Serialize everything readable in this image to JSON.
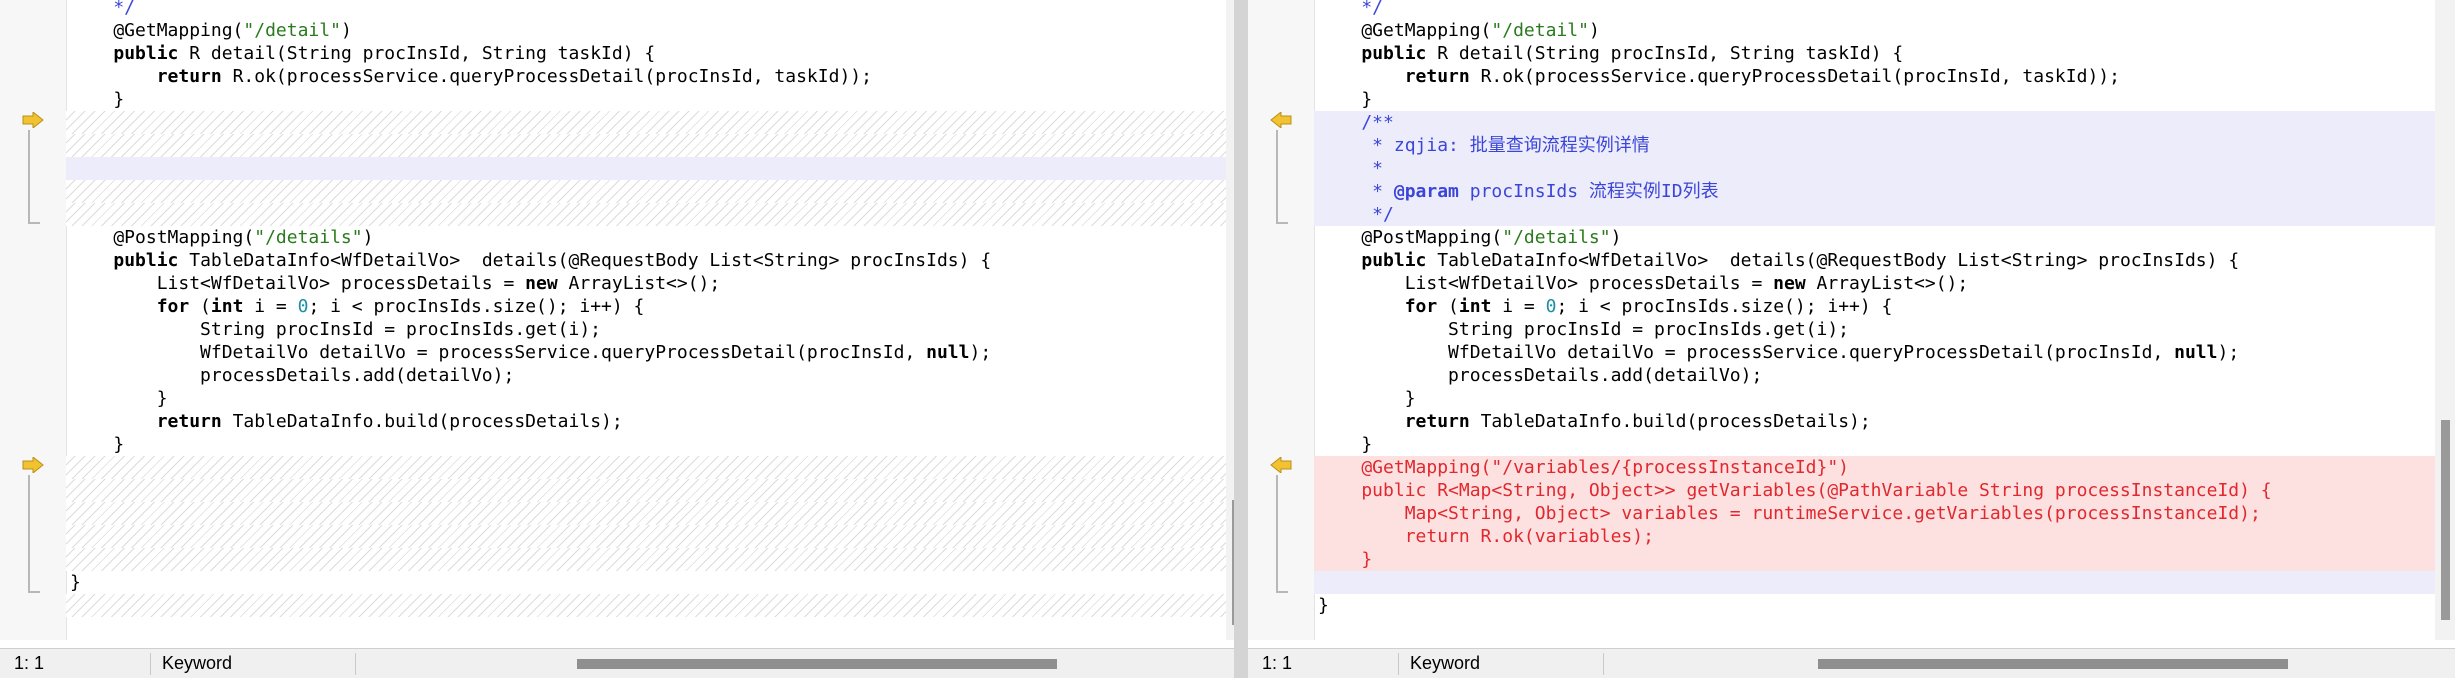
{
  "left_pane": {
    "lines": [
      {
        "t": "    */",
        "cls": "cmt"
      },
      {
        "segs": [
          [
            "    @GetMapping(",
            ""
          ],
          [
            "\"/detail\"",
            "str"
          ],
          [
            ")",
            ""
          ]
        ]
      },
      {
        "segs": [
          [
            "    ",
            ""
          ],
          [
            "public",
            "kw"
          ],
          [
            " R detail(String procInsId, String taskId) {",
            ""
          ]
        ]
      },
      {
        "segs": [
          [
            "        ",
            ""
          ],
          [
            "return",
            "kw"
          ],
          [
            " R.ok(processService.queryProcessDetail(procInsId, taskId));",
            ""
          ]
        ]
      },
      {
        "t": "    }"
      },
      {
        "t": "",
        "bg": "hatch"
      },
      {
        "t": "",
        "bg": "hatch"
      },
      {
        "t": "",
        "bg": "blue"
      },
      {
        "t": "",
        "bg": "hatch"
      },
      {
        "t": "",
        "bg": "hatch"
      },
      {
        "segs": [
          [
            "    @PostMapping(",
            ""
          ],
          [
            "\"/details\"",
            "str"
          ],
          [
            ")",
            ""
          ]
        ]
      },
      {
        "segs": [
          [
            "    ",
            ""
          ],
          [
            "public",
            "kw"
          ],
          [
            " TableDataInfo<WfDetailVo>  details(@RequestBody List<String> procInsIds) {",
            ""
          ]
        ]
      },
      {
        "segs": [
          [
            "        List<WfDetailVo> processDetails = ",
            ""
          ],
          [
            "new",
            "kw"
          ],
          [
            " ArrayList<>();",
            ""
          ]
        ]
      },
      {
        "segs": [
          [
            "        ",
            ""
          ],
          [
            "for",
            "kw"
          ],
          [
            " (",
            ""
          ],
          [
            "int",
            "kw"
          ],
          [
            " i = ",
            ""
          ],
          [
            "0",
            "num"
          ],
          [
            "; i < procInsIds.size(); i++) {",
            ""
          ]
        ]
      },
      {
        "t": "            String procInsId = procInsIds.get(i);"
      },
      {
        "segs": [
          [
            "            WfDetailVo detailVo = processService.queryProcessDetail(procInsId, ",
            ""
          ],
          [
            "null",
            "kw"
          ],
          [
            ");",
            ""
          ]
        ]
      },
      {
        "t": "            processDetails.add(detailVo);"
      },
      {
        "t": "        }"
      },
      {
        "segs": [
          [
            "        ",
            ""
          ],
          [
            "return",
            "kw"
          ],
          [
            " TableDataInfo.build(processDetails);",
            ""
          ]
        ]
      },
      {
        "t": "    }"
      },
      {
        "t": "",
        "bg": "hatch"
      },
      {
        "t": "",
        "bg": "hatch"
      },
      {
        "t": "",
        "bg": "hatch"
      },
      {
        "t": "",
        "bg": "hatch"
      },
      {
        "t": "",
        "bg": "hatch"
      },
      {
        "t": "}"
      },
      {
        "t": "",
        "bg": "hatch"
      }
    ],
    "status": {
      "position": "1: 1",
      "mode": "Keyword"
    }
  },
  "right_pane": {
    "lines": [
      {
        "t": "    */",
        "cls": "cmt"
      },
      {
        "segs": [
          [
            "    @GetMapping(",
            ""
          ],
          [
            "\"/detail\"",
            "str"
          ],
          [
            ")",
            ""
          ]
        ]
      },
      {
        "segs": [
          [
            "    ",
            ""
          ],
          [
            "public",
            "kw"
          ],
          [
            " R detail(String procInsId, String taskId) {",
            ""
          ]
        ]
      },
      {
        "segs": [
          [
            "        ",
            ""
          ],
          [
            "return",
            "kw"
          ],
          [
            " R.ok(processService.queryProcessDetail(procInsId, taskId));",
            ""
          ]
        ]
      },
      {
        "t": "    }"
      },
      {
        "t": "    /**",
        "cls": "cmt",
        "bg": "blue"
      },
      {
        "t": "     * zqjia: 批量查询流程实例详情",
        "cls": "cmt",
        "bg": "blue"
      },
      {
        "t": "     *",
        "cls": "cmt",
        "bg": "blue"
      },
      {
        "segs": [
          [
            "     * ",
            "cmt"
          ],
          [
            "@param",
            "tag"
          ],
          [
            " procInsIds 流程实例ID列表",
            "cmt"
          ]
        ],
        "bg": "blue"
      },
      {
        "t": "     */",
        "cls": "cmt",
        "bg": "blue"
      },
      {
        "segs": [
          [
            "    @PostMapping(",
            ""
          ],
          [
            "\"/details\"",
            "str"
          ],
          [
            ")",
            ""
          ]
        ]
      },
      {
        "segs": [
          [
            "    ",
            ""
          ],
          [
            "public",
            "kw"
          ],
          [
            " TableDataInfo<WfDetailVo>  details(@RequestBody List<String> procInsIds) {",
            ""
          ]
        ]
      },
      {
        "segs": [
          [
            "        List<WfDetailVo> processDetails = ",
            ""
          ],
          [
            "new",
            "kw"
          ],
          [
            " ArrayList<>();",
            ""
          ]
        ]
      },
      {
        "segs": [
          [
            "        ",
            ""
          ],
          [
            "for",
            "kw"
          ],
          [
            " (",
            ""
          ],
          [
            "int",
            "kw"
          ],
          [
            " i = ",
            ""
          ],
          [
            "0",
            "num"
          ],
          [
            "; i < procInsIds.size(); i++) {",
            ""
          ]
        ]
      },
      {
        "t": "            String procInsId = procInsIds.get(i);"
      },
      {
        "segs": [
          [
            "            WfDetailVo detailVo = processService.queryProcessDetail(procInsId, ",
            ""
          ],
          [
            "null",
            "kw"
          ],
          [
            ");",
            ""
          ]
        ]
      },
      {
        "t": "            processDetails.add(detailVo);"
      },
      {
        "t": "        }"
      },
      {
        "segs": [
          [
            "        ",
            ""
          ],
          [
            "return",
            "kw"
          ],
          [
            " TableDataInfo.build(processDetails);",
            ""
          ]
        ]
      },
      {
        "t": "    }"
      },
      {
        "t": "    @GetMapping(\"/variables/{processInstanceId}\")",
        "cls": "del",
        "bg": "red"
      },
      {
        "t": "    public R<Map<String, Object>> getVariables(@PathVariable String processInstanceId) {",
        "cls": "del",
        "bg": "red"
      },
      {
        "t": "        Map<String, Object> variables = runtimeService.getVariables(processInstanceId);",
        "cls": "del",
        "bg": "red"
      },
      {
        "t": "        return R.ok(variables);",
        "cls": "del",
        "bg": "red"
      },
      {
        "t": "    }",
        "cls": "del",
        "bg": "red"
      },
      {
        "t": "",
        "bg": "blue"
      },
      {
        "t": "}"
      }
    ],
    "status": {
      "position": "1: 1",
      "mode": "Keyword"
    }
  },
  "markers": {
    "left_icon": "arrow-right-icon",
    "right_icon": "arrow-left-icon",
    "color": "#f2c230"
  }
}
